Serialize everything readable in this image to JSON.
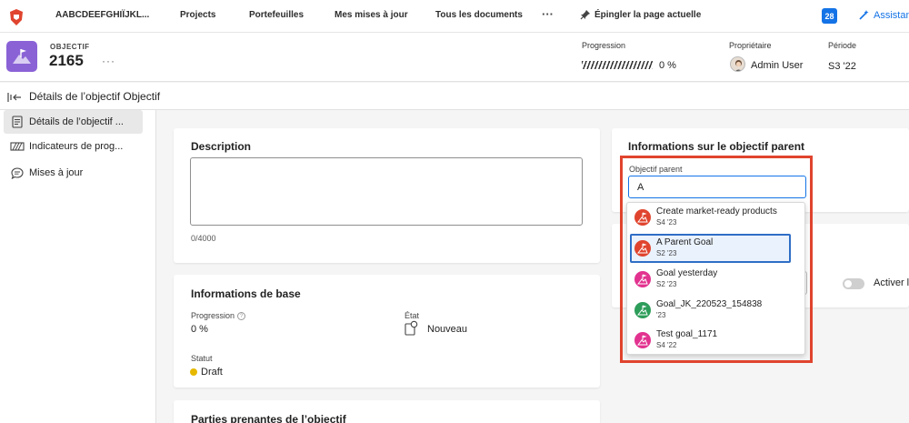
{
  "topnav": {
    "workspace_name": "AABCDEEFGHIÏJKL...",
    "items": [
      {
        "label": "Projects"
      },
      {
        "label": "Portefeuilles"
      },
      {
        "label": "Mes mises à jour"
      },
      {
        "label": "Tous les documents"
      }
    ],
    "more_label": "···",
    "pin_label": "Épingler la page actuelle",
    "notification_count": "28",
    "assistant_label": "Assistant"
  },
  "header": {
    "object_type": "OBJECTIF",
    "object_number": "2165",
    "more_label": "···",
    "progress_label": "Progression",
    "progress_value": "0 %",
    "owner_label": "Propriétaire",
    "owner_name": "Admin User",
    "period_label": "Période",
    "period_value": "S3 '22"
  },
  "breadcrumb": {
    "title": "Détails de l’objectif Objectif"
  },
  "sidebar": {
    "items": [
      {
        "label": "Détails de l’objectif ...",
        "active": true
      },
      {
        "label": "Indicateurs de prog...",
        "active": false
      },
      {
        "label": "Mises à jour",
        "active": false
      }
    ]
  },
  "description_card": {
    "title": "Description",
    "value": "",
    "counter": "0/4000"
  },
  "basic_info": {
    "title": "Informations de base",
    "progress_label": "Progression",
    "progress_value": "0 %",
    "state_label": "État",
    "state_value": "Nouveau",
    "status_label": "Statut",
    "status_value": "Draft"
  },
  "stakeholders": {
    "title": "Parties prenantes de l’objectif"
  },
  "parent_info": {
    "title": "Informations sur le objectif parent",
    "field_label": "Objectif parent",
    "field_value": "A",
    "options": [
      {
        "name": "Create market-ready products",
        "period": "S4 '23",
        "color": "#e0442e",
        "selected": false
      },
      {
        "name": "A Parent Goal",
        "period": "S2 '23",
        "color": "#e0442e",
        "selected": true
      },
      {
        "name": "Goal yesterday",
        "period": "S2 '23",
        "color": "#e2328f",
        "selected": false
      },
      {
        "name": "Goal_JK_220523_154838",
        "period": "'23",
        "color": "#2d9d5a",
        "selected": false
      },
      {
        "name": "Test goal_1171",
        "period": "S4 '22",
        "color": "#e2328f",
        "selected": false
      }
    ]
  },
  "alignment": {
    "toggle_label": "Activer le",
    "toggle_on": false
  },
  "colors": {
    "accent": "#1473e6",
    "brand_purple": "#8a62d6",
    "highlight_red": "#e0442e",
    "status_draft": "#e6b800"
  }
}
